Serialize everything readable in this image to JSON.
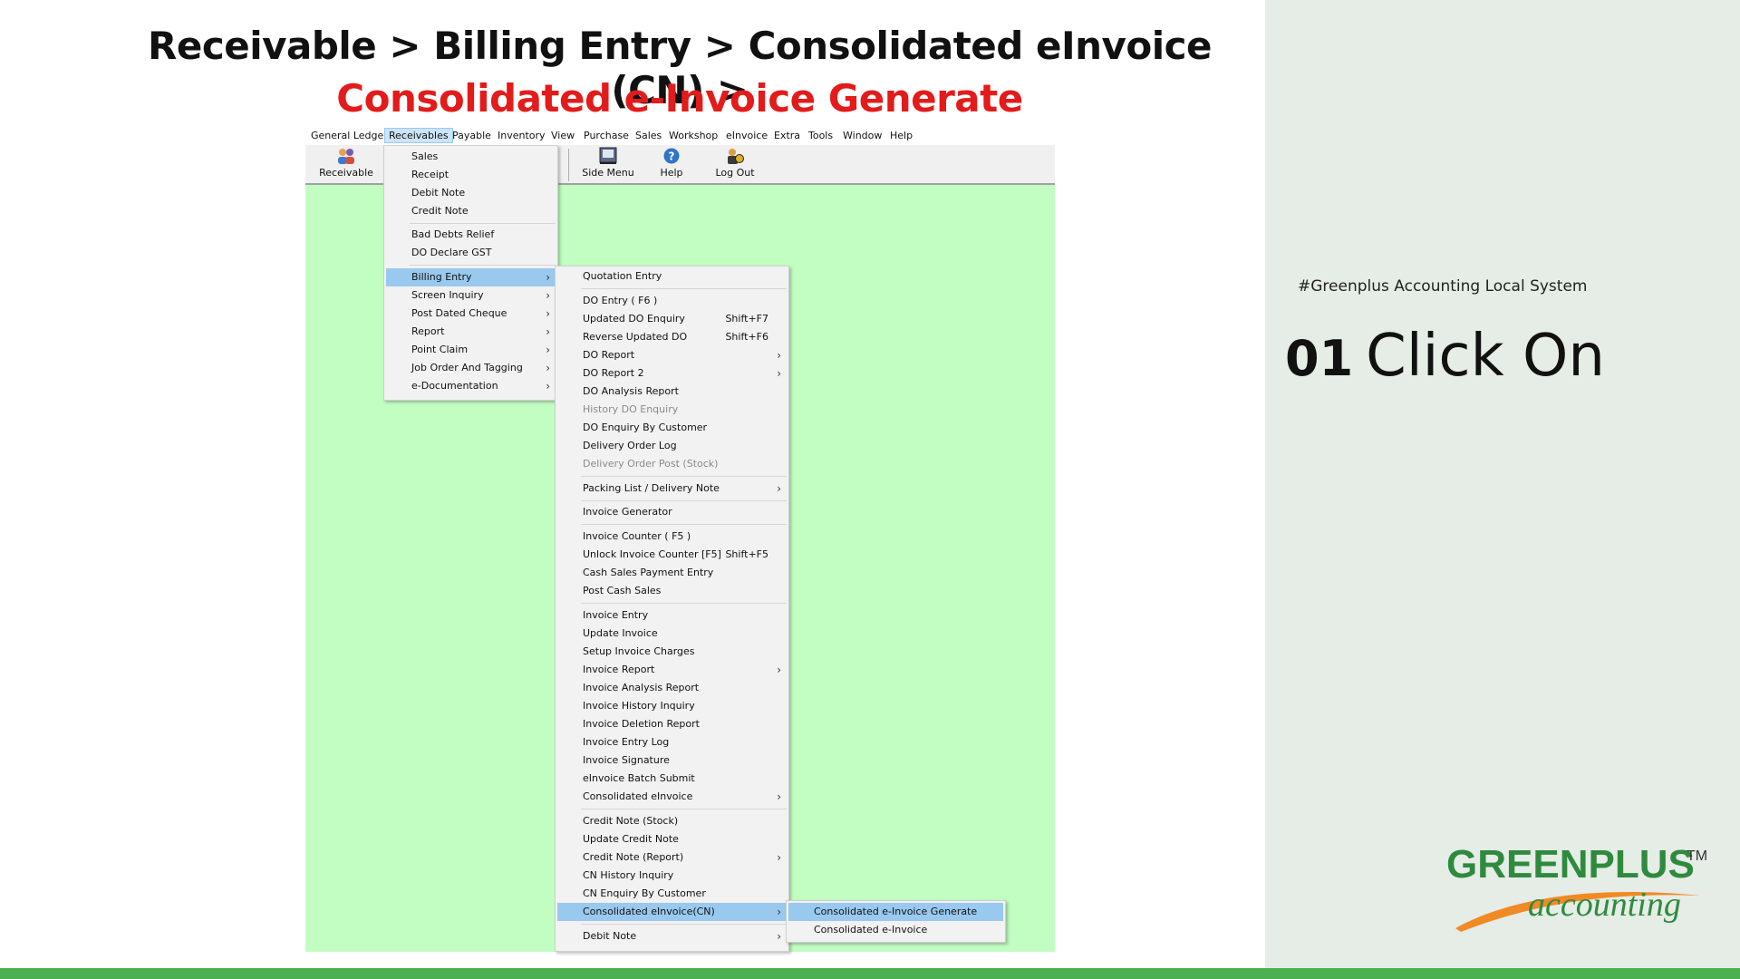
{
  "slide": {
    "breadcrumb": "Receivable > Billing Entry > Consolidated eInvoice (CN) >",
    "heading": "Consolidated e-Invoice Generate",
    "hashtag": "#Greenplus Accounting Local System",
    "step_number": "01",
    "step_text": "Click On",
    "logo_main": "GREENPLUS",
    "logo_tm": "TM",
    "logo_sub": "accounting",
    "colors": {
      "heading_red": "#e31b1b",
      "panel": "#e6ece6",
      "bar": "#4caf50",
      "app_bg": "#c2fdc2",
      "highlight": "#99c9ef"
    }
  },
  "app": {
    "menubar": [
      "General Ledger",
      "Receivables",
      "Payable",
      "Inventory",
      "View",
      "Purchase",
      "Sales",
      "Workshop",
      "eInvoice",
      "Extra",
      "Tools",
      "Window",
      "Help"
    ],
    "active_menu": "Receivables",
    "toolbar": [
      {
        "label": "Receivable",
        "icon": "users-icon"
      },
      {
        "label": "Side Menu",
        "icon": "side-menu-icon"
      },
      {
        "label": "Help",
        "icon": "help-icon"
      },
      {
        "label": "Log Out",
        "icon": "logout-icon"
      }
    ],
    "receivables_menu": [
      "Sales",
      "Receipt",
      "Debit Note",
      "Credit Note",
      "Bad Debts Relief",
      "DO Declare GST",
      "Billing Entry",
      "Screen Inquiry",
      "Post Dated Cheque",
      "Report",
      "Point Claim",
      "Job Order And Tagging",
      "e-Documentation"
    ],
    "billing_menu": [
      "Quotation Entry",
      "DO Entry   ( F6 )",
      "Updated DO Enquiry",
      "Reverse Updated DO",
      "DO Report",
      "DO Report 2",
      "DO Analysis Report",
      "History DO Enquiry",
      "DO Enquiry By Customer",
      "Delivery Order Log",
      "Delivery Order Post (Stock)",
      "Packing List / Delivery Note",
      "Invoice Generator",
      "Invoice Counter    ( F5 )",
      "Unlock Invoice Counter [F5]",
      "Cash Sales Payment Entry",
      "Post Cash Sales",
      "Invoice Entry",
      "Update Invoice",
      "Setup Invoice Charges",
      "Invoice Report",
      "Invoice Analysis Report",
      "Invoice History Inquiry",
      "Invoice Deletion Report",
      "Invoice Entry Log",
      "Invoice Signature",
      "eInvoice Batch Submit",
      "Consolidated eInvoice",
      "Credit Note (Stock)",
      "Update Credit Note",
      "Credit Note (Report)",
      "CN History Inquiry",
      "CN Enquiry By Customer",
      "Consolidated eInvoice(CN)",
      "Debit Note"
    ],
    "shortcuts": {
      "updated_do": "Shift+F7",
      "reverse_do": "Shift+F6",
      "unlock_invoice": "Shift+F5"
    },
    "cn_menu": [
      "Consolidated e-Invoice Generate",
      "Consolidated e-Invoice"
    ]
  }
}
